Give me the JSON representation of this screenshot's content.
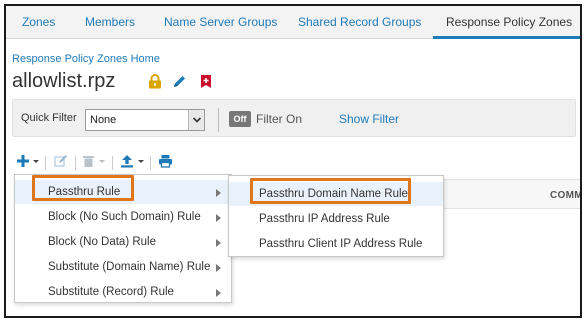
{
  "tabs": [
    {
      "label": "Zones"
    },
    {
      "label": "Members"
    },
    {
      "label": "Name Server Groups"
    },
    {
      "label": "Shared Record Groups"
    },
    {
      "label": "Response Policy Zones"
    }
  ],
  "breadcrumb": "Response Policy Zones Home",
  "page_title": "allowlist.rpz",
  "filter": {
    "quick_filter_label": "Quick Filter",
    "quick_filter_value": "None",
    "toggle_text": "Off",
    "toggle_label": "Filter On",
    "show_filter": "Show Filter"
  },
  "table": {
    "column_comment": "COMME"
  },
  "menu": {
    "items": [
      {
        "label": "Passthru Rule"
      },
      {
        "label": "Block (No Such Domain) Rule"
      },
      {
        "label": "Block (No Data) Rule"
      },
      {
        "label": "Substitute (Domain Name) Rule"
      },
      {
        "label": "Substitute (Record) Rule"
      }
    ]
  },
  "submenu": {
    "items": [
      {
        "label": "Passthru Domain Name Rule"
      },
      {
        "label": "Passthru IP Address Rule"
      },
      {
        "label": "Passthru Client IP Address Rule"
      }
    ]
  },
  "colors": {
    "link": "#1f7ab8",
    "highlight": "#e0751a",
    "lock": "#d9a400",
    "bookmark": "#c8102e"
  }
}
